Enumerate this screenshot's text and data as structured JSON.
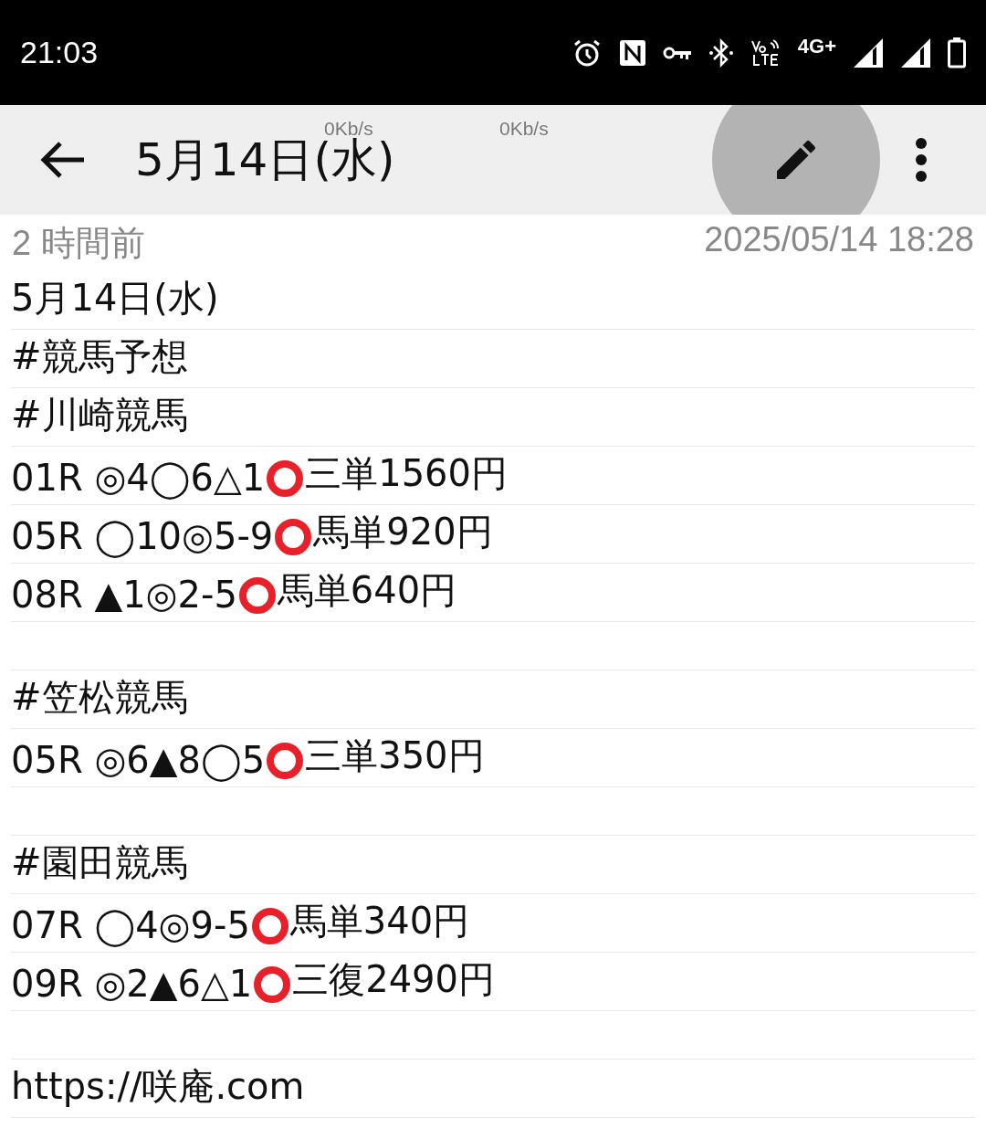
{
  "status_bar": {
    "time": "21:03",
    "network": "4G+"
  },
  "speed_overlays": [
    "0Kb/s",
    "0Kb/s"
  ],
  "app_bar": {
    "title": "5月14日(水)",
    "edit_pressed": true
  },
  "meta": {
    "relative": "2 時間前",
    "timestamp": "2025/05/14 18:28"
  },
  "lines": [
    {
      "segments": [
        {
          "kind": "text",
          "text": "5月14日(水)"
        }
      ]
    },
    {
      "segments": [
        {
          "kind": "text",
          "text": "#競馬予想"
        }
      ]
    },
    {
      "segments": [
        {
          "kind": "text",
          "text": "#川崎競馬"
        }
      ]
    },
    {
      "segments": [
        {
          "kind": "text",
          "text": "01R ◎4◯6△1"
        },
        {
          "kind": "hit"
        },
        {
          "kind": "text",
          "text": "三単1560円"
        }
      ]
    },
    {
      "segments": [
        {
          "kind": "text",
          "text": "05R ◯10◎5-9"
        },
        {
          "kind": "hit"
        },
        {
          "kind": "text",
          "text": "馬単920円"
        }
      ]
    },
    {
      "segments": [
        {
          "kind": "text",
          "text": "08R ▲1◎2-5"
        },
        {
          "kind": "hit"
        },
        {
          "kind": "text",
          "text": "馬単640円"
        }
      ]
    },
    {
      "kind": "blank"
    },
    {
      "segments": [
        {
          "kind": "text",
          "text": "#笠松競馬"
        }
      ]
    },
    {
      "segments": [
        {
          "kind": "text",
          "text": "05R ◎6▲8◯5"
        },
        {
          "kind": "hit"
        },
        {
          "kind": "text",
          "text": "三単350円"
        }
      ]
    },
    {
      "kind": "blank"
    },
    {
      "segments": [
        {
          "kind": "text",
          "text": "#園田競馬"
        }
      ]
    },
    {
      "segments": [
        {
          "kind": "text",
          "text": "07R ◯4◎9-5"
        },
        {
          "kind": "hit"
        },
        {
          "kind": "text",
          "text": "馬単340円"
        }
      ]
    },
    {
      "segments": [
        {
          "kind": "text",
          "text": "09R ◎2▲6△1"
        },
        {
          "kind": "hit"
        },
        {
          "kind": "text",
          "text": "三復2490円"
        }
      ]
    },
    {
      "kind": "blank"
    },
    {
      "segments": [
        {
          "kind": "text",
          "text": "https://咲庵.com"
        }
      ]
    }
  ]
}
